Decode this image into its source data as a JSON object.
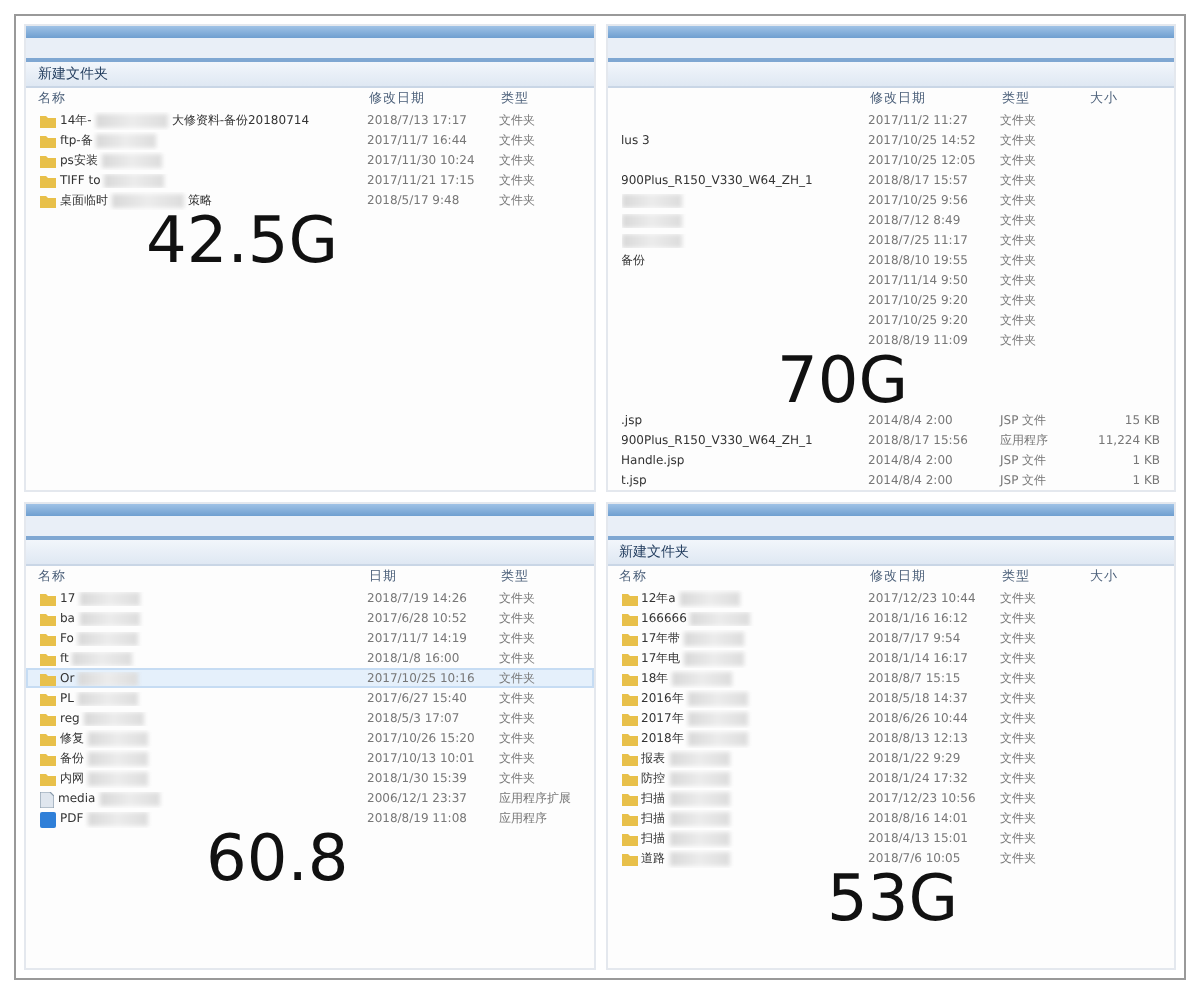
{
  "panels": [
    {
      "toolbar": "新建文件夹",
      "columns": [
        {
          "kind": "name",
          "label": "名称"
        },
        {
          "kind": "date",
          "label": "修改日期"
        },
        {
          "kind": "type",
          "label": "类型"
        }
      ],
      "rows": [
        {
          "kind": "folder",
          "name": "14年-",
          "blurred": true,
          "name_end": "大修资料-备份20180714",
          "date": "2018/7/13 17:17",
          "type": "文件夹",
          "selected": false
        },
        {
          "kind": "folder",
          "name": "ftp-备",
          "blurred": true,
          "date": "2017/11/7 16:44",
          "type": "文件夹",
          "selected": false
        },
        {
          "kind": "folder",
          "name": "ps安装",
          "blurred": true,
          "date": "2017/11/30 10:24",
          "type": "文件夹",
          "selected": false
        },
        {
          "kind": "folder",
          "name": "TIFF to",
          "blurred": true,
          "date": "2017/11/21 17:15",
          "type": "文件夹",
          "selected": false
        },
        {
          "kind": "folder",
          "name": "桌面临时",
          "blurred": true,
          "name_end": "策略",
          "date": "2018/5/17 9:48",
          "type": "文件夹",
          "selected": false
        }
      ],
      "big_label": "42.5G"
    },
    {
      "columns": [
        {
          "kind": "name"
        },
        {
          "kind": "date",
          "label": "修改日期"
        },
        {
          "kind": "type",
          "label": "类型"
        },
        {
          "kind": "size",
          "label": "大小"
        }
      ],
      "rows": [
        {
          "date": "2017/11/2 11:27",
          "type": "文件夹",
          "selected": false
        },
        {
          "name": "lus 3",
          "date": "2017/10/25 14:52",
          "type": "文件夹",
          "selected": false
        },
        {
          "date": "2017/10/25 12:05",
          "type": "文件夹",
          "selected": false
        },
        {
          "name": "900Plus_R150_V330_W64_ZH_1",
          "date": "2018/8/17 15:57",
          "type": "文件夹",
          "selected": false
        },
        {
          "blurred": true,
          "date": "2017/10/25 9:56",
          "type": "文件夹",
          "selected": false
        },
        {
          "blurred": true,
          "date": "2018/7/12 8:49",
          "type": "文件夹",
          "selected": false
        },
        {
          "blurred": true,
          "date": "2018/7/25 11:17",
          "type": "文件夹",
          "selected": false
        },
        {
          "name": "备份",
          "date": "2018/8/10 19:55",
          "type": "文件夹",
          "selected": false
        },
        {
          "date": "2017/11/14 9:50",
          "type": "文件夹",
          "selected": false
        },
        {
          "date": "2017/10/25 9:20",
          "type": "文件夹",
          "selected": false
        },
        {
          "date": "2017/10/25 9:20",
          "type": "文件夹",
          "selected": false
        },
        {
          "date": "2018/8/19 11:09",
          "type": "文件夹",
          "selected": false
        }
      ],
      "big_label": "70G",
      "rows_after": [
        {
          "name": ".jsp",
          "date": "2014/8/4 2:00",
          "type": "JSP 文件",
          "size": "15 KB",
          "selected": false
        },
        {
          "name": "900Plus_R150_V330_W64_ZH_1",
          "date": "2018/8/17 15:56",
          "type": "应用程序",
          "size": "11,224 KB",
          "selected": false
        },
        {
          "name": "Handle.jsp",
          "date": "2014/8/4 2:00",
          "type": "JSP 文件",
          "size": "1 KB",
          "selected": false
        },
        {
          "name": "t.jsp",
          "date": "2014/8/4 2:00",
          "type": "JSP 文件",
          "size": "1 KB",
          "selected": false
        }
      ]
    },
    {
      "columns": [
        {
          "kind": "name",
          "label": "名称"
        },
        {
          "kind": "date",
          "label": "日期"
        },
        {
          "kind": "type",
          "label": "类型"
        }
      ],
      "rows": [
        {
          "kind": "folder",
          "name": "17",
          "blurred": true,
          "date": "2018/7/19 14:26",
          "type": "文件夹",
          "selected": false
        },
        {
          "kind": "folder",
          "name": "ba",
          "blurred": true,
          "date": "2017/6/28 10:52",
          "type": "文件夹",
          "selected": false
        },
        {
          "kind": "folder",
          "name": "Fo",
          "blurred": true,
          "date": "2017/11/7 14:19",
          "type": "文件夹",
          "selected": false
        },
        {
          "kind": "folder",
          "name": "ft",
          "blurred": true,
          "date": "2018/1/8 16:00",
          "type": "文件夹",
          "selected": false
        },
        {
          "kind": "folder",
          "name": "Or",
          "blurred": true,
          "date": "2017/10/25 10:16",
          "type": "文件夹",
          "selected": true
        },
        {
          "kind": "folder",
          "name": "PL",
          "blurred": true,
          "date": "2017/6/27 15:40",
          "type": "文件夹",
          "selected": false
        },
        {
          "kind": "folder",
          "name": "reg",
          "blurred": true,
          "date": "2018/5/3 17:07",
          "type": "文件夹",
          "selected": false
        },
        {
          "kind": "folder",
          "name": "修复",
          "blurred": true,
          "date": "2017/10/26 15:20",
          "type": "文件夹",
          "selected": false
        },
        {
          "kind": "folder",
          "name": "备份",
          "blurred": true,
          "date": "2017/10/13 10:01",
          "type": "文件夹",
          "selected": false
        },
        {
          "kind": "folder",
          "name": "内网",
          "blurred": true,
          "date": "2018/1/30 15:39",
          "type": "文件夹",
          "selected": false
        },
        {
          "kind": "file",
          "name": "media",
          "blurred": true,
          "date": "2006/12/1 23:37",
          "type": "应用程序扩展",
          "selected": false
        },
        {
          "kind": "app",
          "name": "PDF",
          "blurred": true,
          "date": "2018/8/19 11:08",
          "type": "应用程序",
          "selected": false
        }
      ],
      "big_label": "60.8"
    },
    {
      "toolbar": "新建文件夹",
      "columns": [
        {
          "kind": "name",
          "label": "名称"
        },
        {
          "kind": "date",
          "label": "修改日期"
        },
        {
          "kind": "type",
          "label": "类型"
        },
        {
          "kind": "size",
          "label": "大小"
        }
      ],
      "rows": [
        {
          "kind": "folder",
          "name": "12年a",
          "blurred": true,
          "date": "2017/12/23 10:44",
          "type": "文件夹",
          "selected": false
        },
        {
          "kind": "folder",
          "name": "166666",
          "blurred": true,
          "date": "2018/1/16 16:12",
          "type": "文件夹",
          "selected": false
        },
        {
          "kind": "folder",
          "name": "17年带",
          "blurred": true,
          "date": "2018/7/17 9:54",
          "type": "文件夹",
          "selected": false
        },
        {
          "kind": "folder",
          "name": "17年电",
          "blurred": true,
          "date": "2018/1/14 16:17",
          "type": "文件夹",
          "selected": false
        },
        {
          "kind": "folder",
          "name": "18年",
          "blurred": true,
          "date": "2018/8/7 15:15",
          "type": "文件夹",
          "selected": false
        },
        {
          "kind": "folder",
          "name": "2016年",
          "blurred": true,
          "date": "2018/5/18 14:37",
          "type": "文件夹",
          "selected": false
        },
        {
          "kind": "folder",
          "name": "2017年",
          "blurred": true,
          "date": "2018/6/26 10:44",
          "type": "文件夹",
          "selected": false
        },
        {
          "kind": "folder",
          "name": "2018年",
          "blurred": true,
          "date": "2018/8/13 12:13",
          "type": "文件夹",
          "selected": false
        },
        {
          "kind": "folder",
          "name": "报表",
          "blurred": true,
          "date": "2018/1/22 9:29",
          "type": "文件夹",
          "selected": false
        },
        {
          "kind": "folder",
          "name": "防控",
          "blurred": true,
          "date": "2018/1/24 17:32",
          "type": "文件夹",
          "selected": false
        },
        {
          "kind": "folder",
          "name": "扫描",
          "blurred": true,
          "date": "2017/12/23 10:56",
          "type": "文件夹",
          "selected": false
        },
        {
          "kind": "folder",
          "name": "扫描",
          "blurred": true,
          "date": "2018/8/16 14:01",
          "type": "文件夹",
          "selected": false
        },
        {
          "kind": "folder",
          "name": "扫描",
          "blurred": true,
          "date": "2018/4/13 15:01",
          "type": "文件夹",
          "selected": false
        },
        {
          "kind": "folder",
          "name": "道路",
          "blurred": true,
          "date": "2018/7/6 10:05",
          "type": "文件夹",
          "selected": false
        }
      ],
      "big_label": "53G"
    }
  ]
}
